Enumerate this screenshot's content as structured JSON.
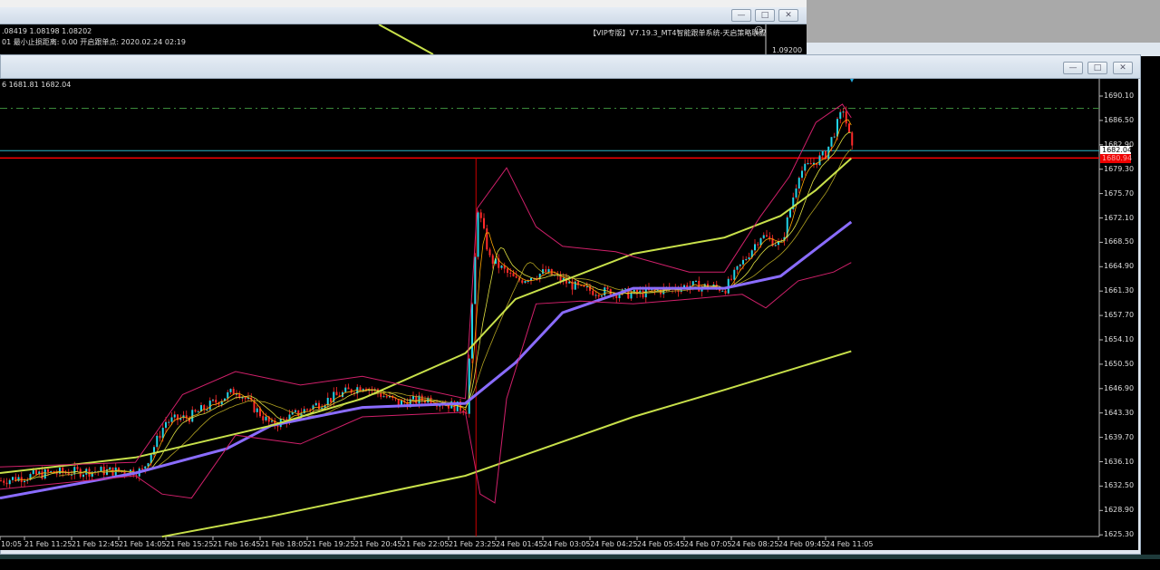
{
  "back_window": {
    "ohlc_text": ".08419 1.08198 1.08202",
    "info_text": "01  最小止损距离: 0.00   开启跟单点: 2020.02.24 02:19",
    "ea_label": "【VIP专版】V7.19.3_MT4智能跟单系统-天启策略联盟",
    "smiley_icon": "☺",
    "price_label": "1.09200"
  },
  "main_window": {
    "ohlc_text": "6 1681.81 1682.04",
    "buttons": {
      "minimize": "—",
      "maximize": "□",
      "close": "✕"
    },
    "bid_label": "1682.04",
    "ask_label": "1680.94",
    "price_axis": [
      "1690.10",
      "1686.50",
      "1682.90",
      "1679.30",
      "1675.70",
      "1672.10",
      "1668.50",
      "1664.90",
      "1661.30",
      "1657.70",
      "1654.10",
      "1650.50",
      "1646.90",
      "1643.30",
      "1639.70",
      "1636.10",
      "1632.50",
      "1628.90",
      "1625.30"
    ],
    "time_axis": [
      "10:05",
      "21 Feb 11:25",
      "21 Feb 12:45",
      "21 Feb 14:05",
      "21 Feb 15:25",
      "21 Feb 16:45",
      "21 Feb 18:05",
      "21 Feb 19:25",
      "21 Feb 20:45",
      "21 Feb 22:05",
      "21 Feb 23:25",
      "24 Feb 01:45",
      "24 Feb 03:05",
      "24 Feb 04:25",
      "24 Feb 05:45",
      "24 Feb 07:05",
      "24 Feb 08:25",
      "24 Feb 09:45",
      "24 Feb 11:05"
    ]
  },
  "colors": {
    "bull": "#22d3e6",
    "bear": "#ff2a2a",
    "ma_slow": "#8a6cff",
    "ma_long": "#c8e04a",
    "bands": "#d0206a",
    "bid_line": "#2ab7c9",
    "ask_line": "#ff0000",
    "level_line": "#3b8a3b"
  },
  "chart_data": {
    "type": "candlestick",
    "ylim": [
      1625.3,
      1690.1
    ],
    "bid": 1682.04,
    "ask": 1680.94,
    "level": 1688.3,
    "spike_bar": 161,
    "close_anchors": [
      [
        0,
        1633.3
      ],
      [
        16,
        1634.4
      ],
      [
        32,
        1634.7
      ],
      [
        48,
        1634.7
      ],
      [
        56,
        1642
      ],
      [
        64,
        1642.7
      ],
      [
        80,
        1646.7
      ],
      [
        92,
        1641.4
      ],
      [
        108,
        1644.7
      ],
      [
        123,
        1647.4
      ],
      [
        135,
        1644.7
      ],
      [
        145,
        1645.4
      ],
      [
        158,
        1643.8
      ],
      [
        162,
        1673.5
      ],
      [
        166,
        1666.1
      ],
      [
        175,
        1662.8
      ],
      [
        185,
        1664.1
      ],
      [
        197,
        1661.5
      ],
      [
        215,
        1660.8
      ],
      [
        234,
        1662.1
      ],
      [
        246,
        1661.7
      ],
      [
        258,
        1669.5
      ],
      [
        265,
        1668.1
      ],
      [
        271,
        1678.8
      ],
      [
        280,
        1681.5
      ],
      [
        286,
        1688.2
      ],
      [
        289,
        1682.1
      ]
    ],
    "series": [
      {
        "name": "ma_slow",
        "points": [
          [
            0,
            1630.7
          ],
          [
            46,
            1634.4
          ],
          [
            77,
            1638
          ],
          [
            92,
            1641.4
          ],
          [
            123,
            1644.1
          ],
          [
            158,
            1644.7
          ],
          [
            175,
            1650.7
          ],
          [
            191,
            1658.1
          ],
          [
            215,
            1661.7
          ],
          [
            246,
            1661.7
          ],
          [
            265,
            1663.5
          ],
          [
            277,
            1667.5
          ],
          [
            289,
            1671.5
          ]
        ]
      },
      {
        "name": "ma_long_upper",
        "points": [
          [
            0,
            1634.4
          ],
          [
            46,
            1636.7
          ],
          [
            92,
            1641.4
          ],
          [
            123,
            1645.4
          ],
          [
            158,
            1652.1
          ],
          [
            175,
            1660.1
          ],
          [
            215,
            1666.8
          ],
          [
            246,
            1669.2
          ],
          [
            265,
            1672.4
          ],
          [
            277,
            1676.2
          ],
          [
            289,
            1680.9
          ]
        ]
      },
      {
        "name": "ma_long_lower",
        "points": [
          [
            55,
            1625.0
          ],
          [
            92,
            1628.0
          ],
          [
            158,
            1634.0
          ],
          [
            215,
            1642.7
          ],
          [
            246,
            1646.7
          ],
          [
            289,
            1652.4
          ]
        ]
      },
      {
        "name": "band_upper",
        "points": [
          [
            0,
            1635.3
          ],
          [
            46,
            1636.0
          ],
          [
            62,
            1646.0
          ],
          [
            80,
            1649.4
          ],
          [
            102,
            1647.4
          ],
          [
            123,
            1648.7
          ],
          [
            158,
            1645.4
          ],
          [
            162,
            1673.5
          ],
          [
            172,
            1679.5
          ],
          [
            182,
            1670.8
          ],
          [
            191,
            1667.9
          ],
          [
            209,
            1667.1
          ],
          [
            234,
            1664.1
          ],
          [
            246,
            1664.1
          ],
          [
            258,
            1672.2
          ],
          [
            268,
            1678.2
          ],
          [
            277,
            1686.2
          ],
          [
            286,
            1688.9
          ],
          [
            289,
            1686.9
          ]
        ]
      },
      {
        "name": "band_lower",
        "points": [
          [
            0,
            1632.0
          ],
          [
            46,
            1634.0
          ],
          [
            55,
            1631.3
          ],
          [
            65,
            1630.7
          ],
          [
            80,
            1640.0
          ],
          [
            102,
            1638.7
          ],
          [
            123,
            1642.7
          ],
          [
            158,
            1643.4
          ],
          [
            163,
            1631.3
          ],
          [
            168,
            1630.0
          ],
          [
            172,
            1645.4
          ],
          [
            182,
            1659.4
          ],
          [
            197,
            1659.8
          ],
          [
            215,
            1659.4
          ],
          [
            234,
            1660.1
          ],
          [
            252,
            1660.8
          ],
          [
            260,
            1658.8
          ],
          [
            271,
            1662.8
          ],
          [
            283,
            1664.1
          ],
          [
            289,
            1665.5
          ]
        ]
      }
    ]
  }
}
